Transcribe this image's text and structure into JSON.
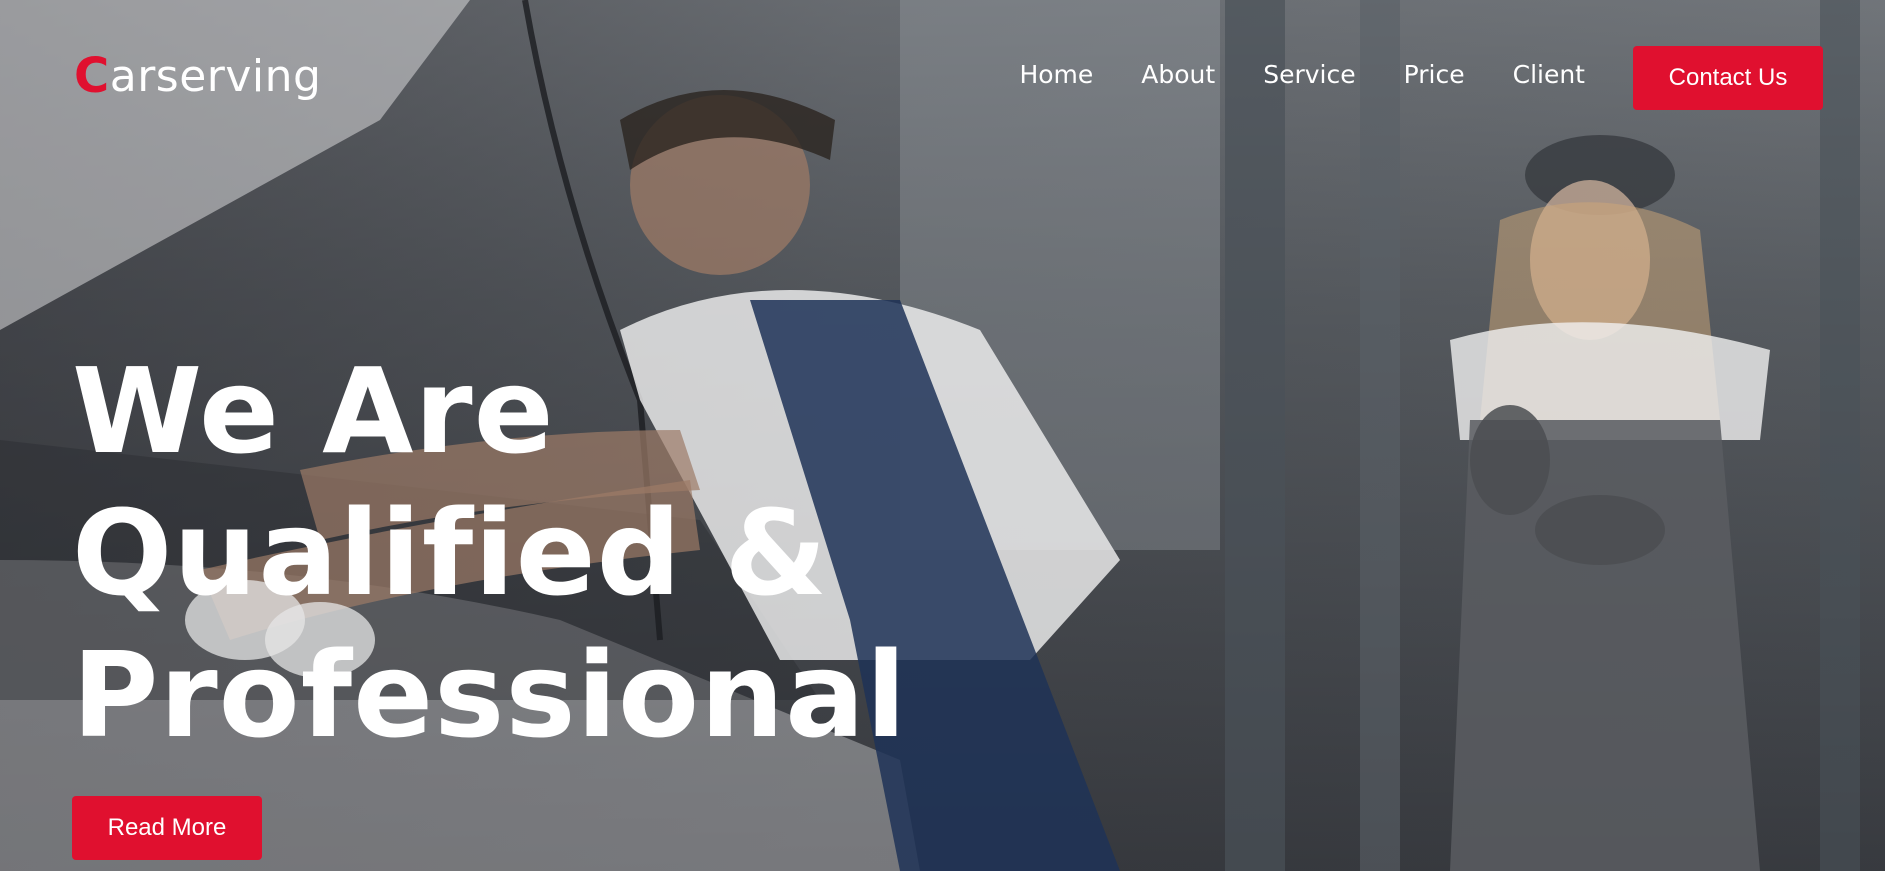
{
  "brand": {
    "logo_mark": "C",
    "logo_rest": "arserving",
    "accent_color": "#e0102f"
  },
  "nav": {
    "items": [
      "Home",
      "About",
      "Service",
      "Price",
      "Client"
    ],
    "contact_label": "Contact Us"
  },
  "hero": {
    "headline_lines": [
      "We Are",
      "Qualified &",
      "Professional"
    ],
    "cta_label": "Read More",
    "background_image": "mechanics-working-on-car-in-garage"
  }
}
